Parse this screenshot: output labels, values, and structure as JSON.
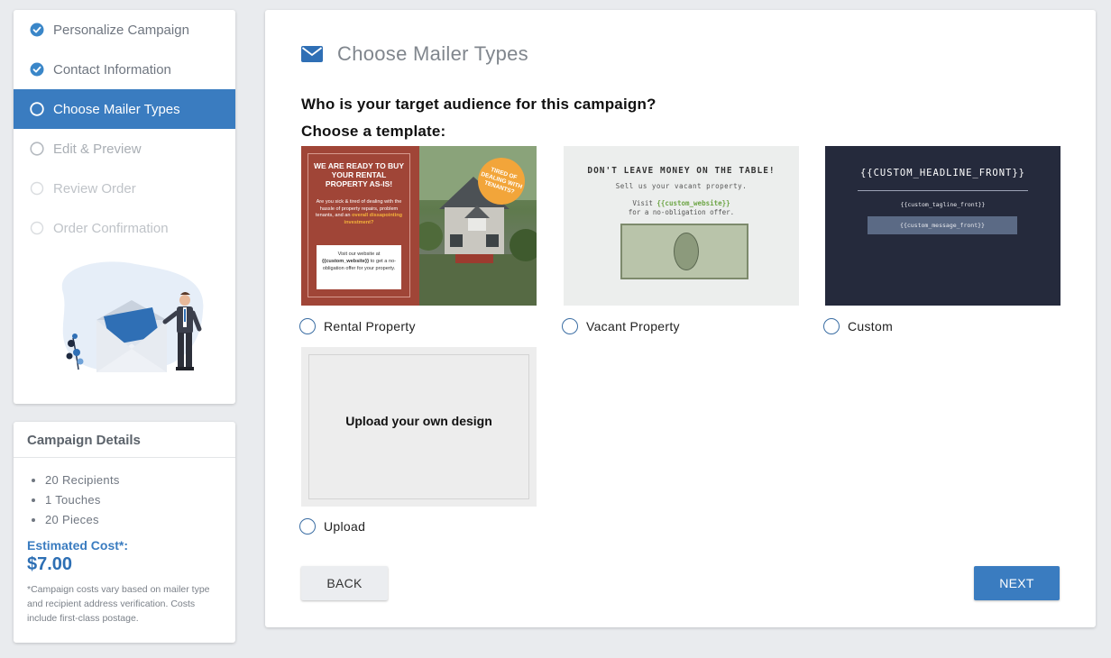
{
  "steps": [
    {
      "label": "Personalize Campaign",
      "state": "done"
    },
    {
      "label": "Contact Information",
      "state": "done"
    },
    {
      "label": "Choose Mailer Types",
      "state": "active"
    },
    {
      "label": "Edit & Preview",
      "state": "pending"
    },
    {
      "label": "Review Order",
      "state": "disabled"
    },
    {
      "label": "Order Confirmation",
      "state": "disabled"
    }
  ],
  "details": {
    "title": "Campaign Details",
    "items": [
      "20 Recipients",
      "1 Touches",
      "20 Pieces"
    ],
    "estimated_label": "Estimated Cost*:",
    "estimated_value": "$7.00",
    "note": "*Campaign costs vary based on mailer type and recipient address verification. Costs include first-class postage."
  },
  "main": {
    "title": "Choose Mailer Types",
    "title_icon": "envelope-icon",
    "question": "Who is your target audience for this campaign?",
    "template_heading": "Choose a template:"
  },
  "templates": {
    "rental": {
      "label": "Rental Property",
      "headline": "WE ARE READY TO BUY YOUR RENTAL PROPERTY AS-IS!",
      "body_start": "Are you sick & tired of dealing with the hassle of property repairs, problem tenants, and an ",
      "body_highlight": "overall dissapointing investment?",
      "box_line1": "Visit our website at",
      "box_website": "{{custom_website}}",
      "box_line2": " to get a no-obligation offer for your property.",
      "badge": "TIRED OF DEALING WITH TENANTS?"
    },
    "vacant": {
      "label": "Vacant Property",
      "headline": "DON'T LEAVE MONEY ON THE TABLE!",
      "subline": "Sell us your vacant property.",
      "visit": "Visit ",
      "website": "{{custom_website}}",
      "offer": "for a no-obligation offer."
    },
    "custom": {
      "label": "Custom",
      "headline": "{{CUSTOM_HEADLINE_FRONT}}",
      "tagline": "{{custom_tagline_front}}",
      "message": "{{custom_message_front}}"
    },
    "upload": {
      "label": "Upload",
      "text": "Upload your own design"
    }
  },
  "buttons": {
    "back": "BACK",
    "next": "NEXT"
  },
  "colors": {
    "accent": "#3a7cc0",
    "rental_bg": "#a04537",
    "custom_bg": "#252a3c"
  }
}
